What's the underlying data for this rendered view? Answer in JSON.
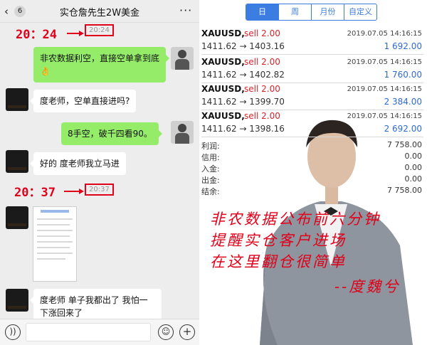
{
  "chat": {
    "header": {
      "back": "‹",
      "unread": "6",
      "title": "实仓詹先生2W美金",
      "more": "···"
    },
    "annotation_1": "20：24",
    "timestamp_1": "20:24",
    "messages_1": [
      {
        "from": "me",
        "text": "非农数据利空，直接空单拿到底👌"
      },
      {
        "from": "other",
        "text": "度老师，空单直接进吗?"
      },
      {
        "from": "me",
        "text": "8手空，破千四看90。"
      },
      {
        "from": "other",
        "text": "好的 度老师我立马进"
      }
    ],
    "annotation_2": "20：37",
    "timestamp_2": "20:37",
    "last_message": {
      "from": "other",
      "text": "度老师 单子我都出了 我怕一下涨回来了"
    }
  },
  "trade": {
    "tabs": [
      {
        "label": "日",
        "active": true
      },
      {
        "label": "周",
        "active": false
      },
      {
        "label": "月份",
        "active": false
      },
      {
        "label": "自定义",
        "active": false
      }
    ],
    "rows": [
      {
        "symbol": "XAUUSD,",
        "direction": "sell 2.00",
        "time": "2019.07.05 14:16:15",
        "prices": "1411.62 → 1403.16",
        "profit": "1 692.00"
      },
      {
        "symbol": "XAUUSD,",
        "direction": "sell 2.00",
        "time": "2019.07.05 14:16:15",
        "prices": "1411.62 → 1402.82",
        "profit": "1 760.00"
      },
      {
        "symbol": "XAUUSD,",
        "direction": "sell 2.00",
        "time": "2019.07.05 14:16:15",
        "prices": "1411.62 → 1399.70",
        "profit": "2 384.00"
      },
      {
        "symbol": "XAUUSD,",
        "direction": "sell 2.00",
        "time": "2019.07.05 14:16:15",
        "prices": "1411.62 → 1398.16",
        "profit": "2 692.00"
      }
    ],
    "summary": [
      {
        "label": "利润:",
        "value": "7 758.00"
      },
      {
        "label": "信用:",
        "value": "0.00"
      },
      {
        "label": "入金:",
        "value": "0.00"
      },
      {
        "label": "出金:",
        "value": "0.00"
      },
      {
        "label": "结余:",
        "value": "7 758.00"
      }
    ],
    "overlay_lines": [
      "非农数据公布前六分钟",
      "提醒实仓客户进场",
      "在这里翻仓很简单",
      "--度魏兮"
    ]
  },
  "colors": {
    "annotation_red": "#e0001a",
    "bubble_green": "#95ec69",
    "tab_blue": "#3b7de0",
    "sell_red": "#d8232a",
    "profit_blue": "#2e6cd1"
  }
}
